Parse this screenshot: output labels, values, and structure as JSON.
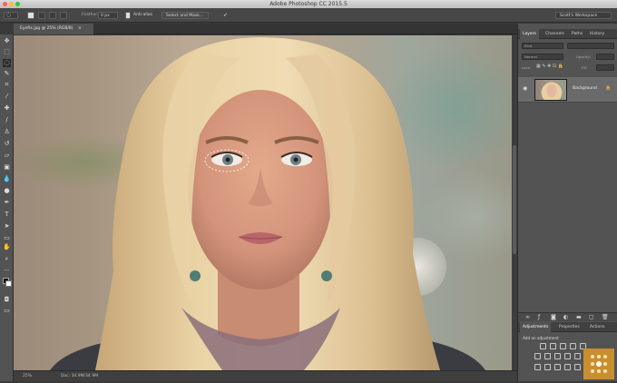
{
  "titlebar": {
    "title": "Adobe Photoshop CC 2015.5"
  },
  "options": {
    "feather_label": "Feather:",
    "feather_value": "0 px",
    "antialias_label": "Anti-alias",
    "select_mask_label": "Select and Mask...",
    "workspace_label": "Scott's Workspace"
  },
  "document": {
    "tab_label": "Eyefix.jpg @ 25% (RGB/8)"
  },
  "status": {
    "zoom": "25%",
    "doc_info": "Doc: 34.9M/34.9M"
  },
  "layers_panel": {
    "tabs": [
      "Layers",
      "Channels",
      "Paths",
      "History"
    ],
    "filter_placeholder": "Kind",
    "blend_mode": "Normal",
    "opacity_label": "Opacity:",
    "lock_label": "Lock:",
    "fill_label": "Fill:",
    "layer_name": "Background"
  },
  "adjustments_panel": {
    "tabs": [
      "Adjustments",
      "Properties",
      "Actions"
    ],
    "hint": "Add an adjustment"
  },
  "colors": {
    "accent": "#c98f2e",
    "panel": "#535353",
    "dark": "#3a3a3a"
  }
}
